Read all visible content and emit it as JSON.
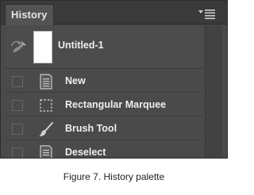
{
  "panel": {
    "tab_title": "History",
    "menu_icon": "panel-menu-icon"
  },
  "snapshot": {
    "label": "Untitled-1",
    "source_icon": "history-brush-source-icon"
  },
  "history_items": [
    {
      "label": "New",
      "icon": "document-icon"
    },
    {
      "label": "Rectangular Marquee",
      "icon": "rectangular-marquee-icon"
    },
    {
      "label": "Brush Tool",
      "icon": "brush-icon"
    },
    {
      "label": "Deselect",
      "icon": "document-icon"
    }
  ],
  "caption": "Figure 7. History palette",
  "colors": {
    "panel_bg": "#4a4a4a",
    "header_bg": "#3a3a3a",
    "text": "#eeeeee"
  }
}
